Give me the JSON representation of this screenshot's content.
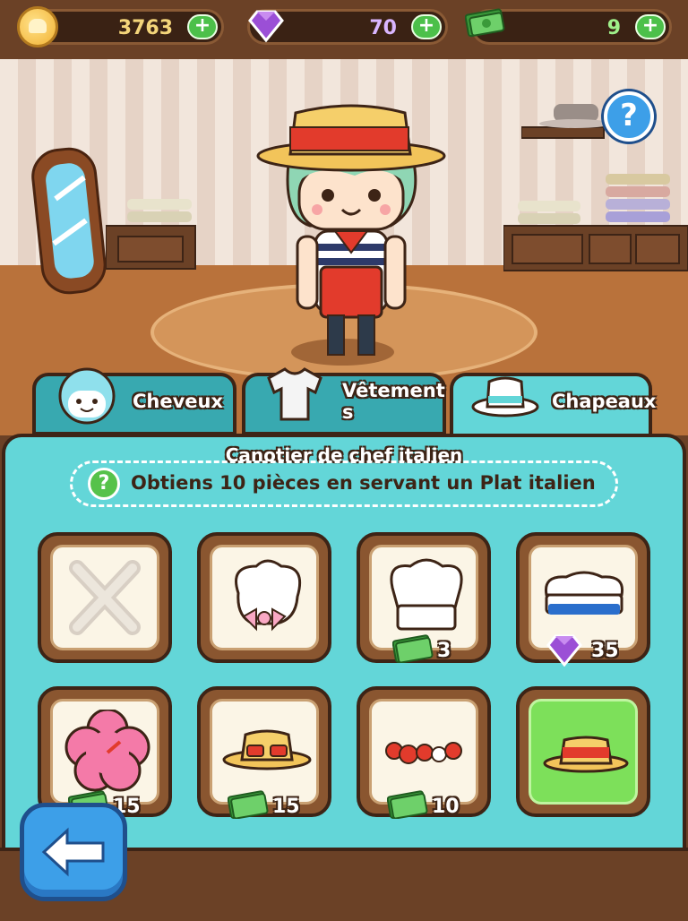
{
  "currency": {
    "coins": "3763",
    "gems": "70",
    "cash": "9"
  },
  "tabs": [
    {
      "label": "Cheveux",
      "icon": "hair-icon"
    },
    {
      "label": "Vêtement\ns",
      "icon": "shirt-icon"
    },
    {
      "label": "Chapeaux",
      "icon": "hat-icon",
      "active": true
    }
  ],
  "panel": {
    "title": "Canotier de chef italien",
    "hint": "Obtiens 10  pièces en servant un Plat italien"
  },
  "items": [
    {
      "name": "none",
      "price": null,
      "currency": null
    },
    {
      "name": "chef-hat-bow",
      "price": null,
      "currency": null
    },
    {
      "name": "chef-toque",
      "price": "3",
      "currency": "cash"
    },
    {
      "name": "sailor-cap",
      "price": "35",
      "currency": "gem"
    },
    {
      "name": "hibiscus-flower",
      "price": "15",
      "currency": "cash"
    },
    {
      "name": "straw-hat-sunglasses",
      "price": "15",
      "currency": "cash"
    },
    {
      "name": "red-bead-headband",
      "price": "10",
      "currency": "cash"
    },
    {
      "name": "boater-hat",
      "price": null,
      "currency": null,
      "selected": true
    }
  ],
  "colors": {
    "panel": "#63d6d8",
    "selected_slot": "#7de05a",
    "cash_green": "#4cc04a",
    "gem_purple": "#9b4fd6"
  }
}
